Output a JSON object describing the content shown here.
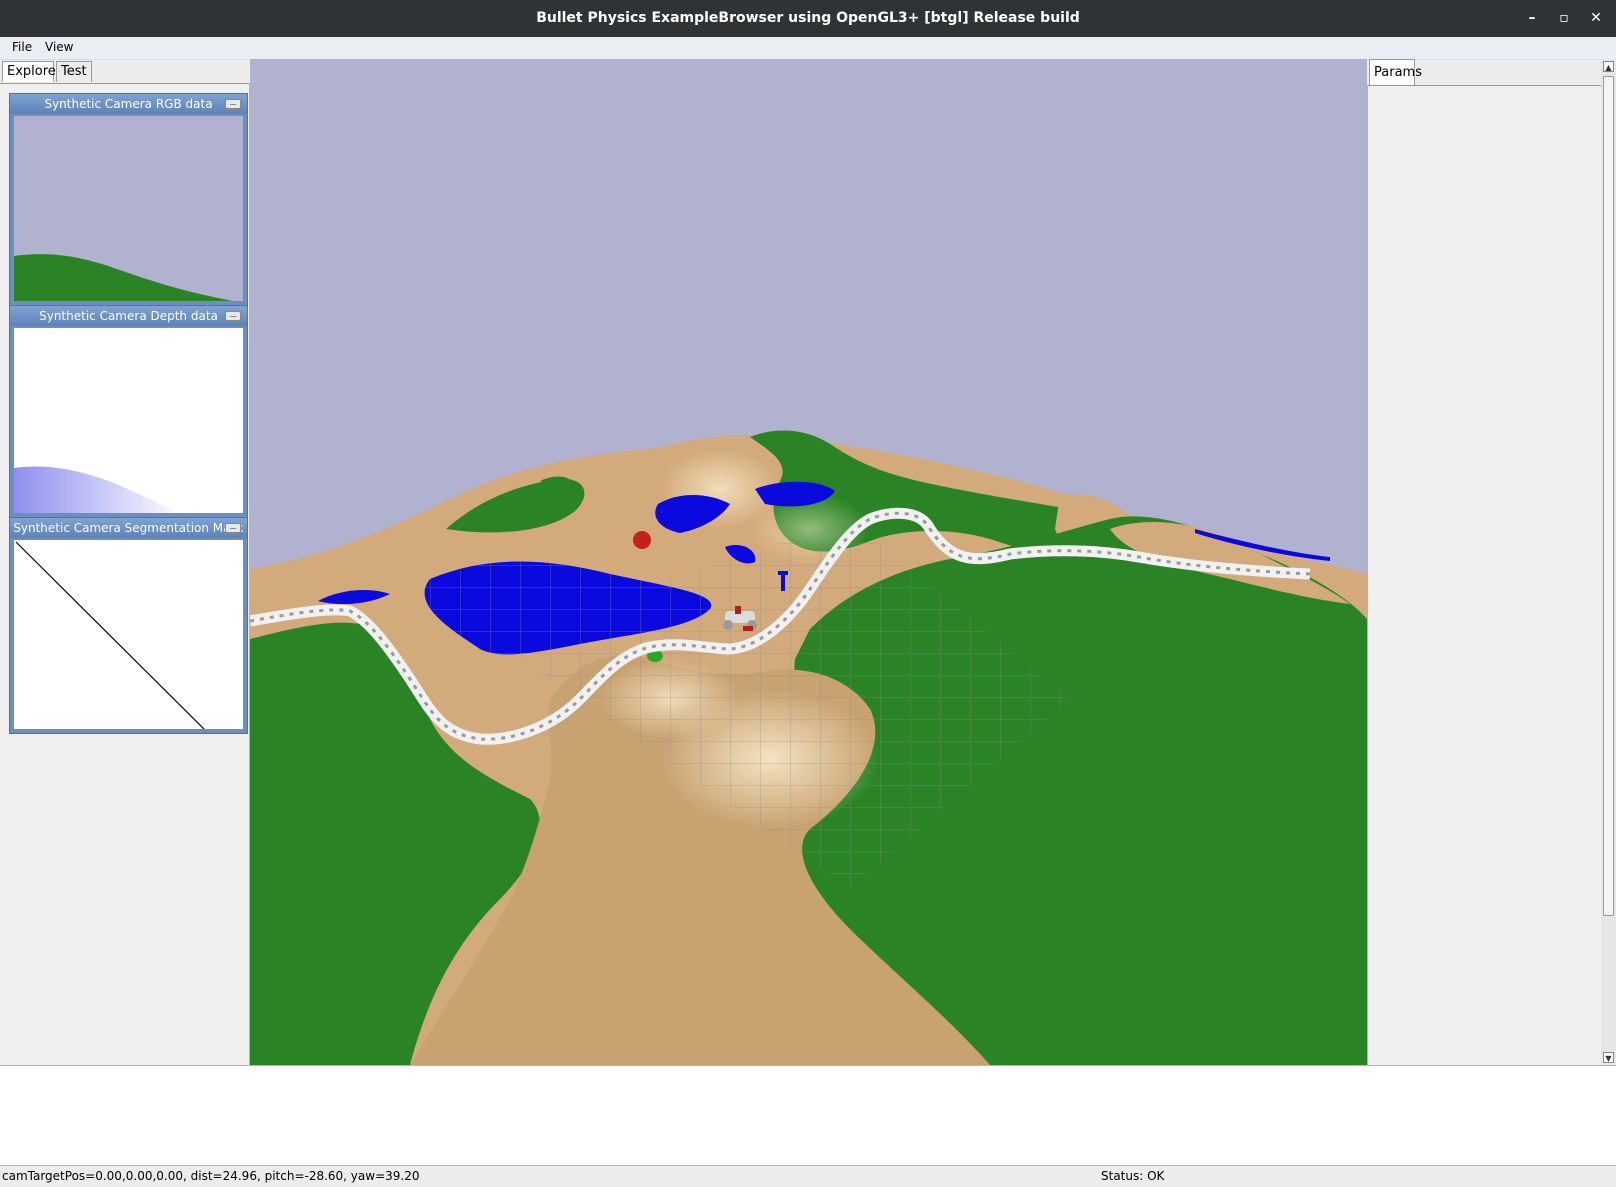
{
  "window": {
    "title": "Bullet Physics ExampleBrowser using OpenGL3+ [btgl] Release build",
    "minimize_glyph": "–",
    "maximize_glyph": "▫",
    "close_glyph": "✕"
  },
  "menu": {
    "items": [
      {
        "label": "File"
      },
      {
        "label": "View"
      }
    ]
  },
  "left_panel": {
    "tabs": [
      {
        "label": "Explorer",
        "active": true
      },
      {
        "label": "Test",
        "active": false
      }
    ]
  },
  "camera_windows": [
    {
      "title": "Synthetic Camera RGB data",
      "close_glyph": "—"
    },
    {
      "title": "Synthetic Camera Depth data",
      "close_glyph": "—"
    },
    {
      "title": "Synthetic Camera Segmentation Mask",
      "close_glyph": "—"
    }
  ],
  "right_panel": {
    "tabs": [
      {
        "label": "Params",
        "active": true
      }
    ]
  },
  "scrollbar": {
    "up_glyph": "▲",
    "down_glyph": "▼"
  },
  "status": {
    "camera": "camTargetPos=0.00,0.00,0.00, dist=24.96, pitch=-28.60, yaw=39.20",
    "state": "Status: OK"
  },
  "colors": {
    "sky": "#b1b1d0",
    "grass": "#2a8425",
    "sand": "#d5ad7e",
    "water": "#0a0adf",
    "title_bar": "#2f3336"
  }
}
